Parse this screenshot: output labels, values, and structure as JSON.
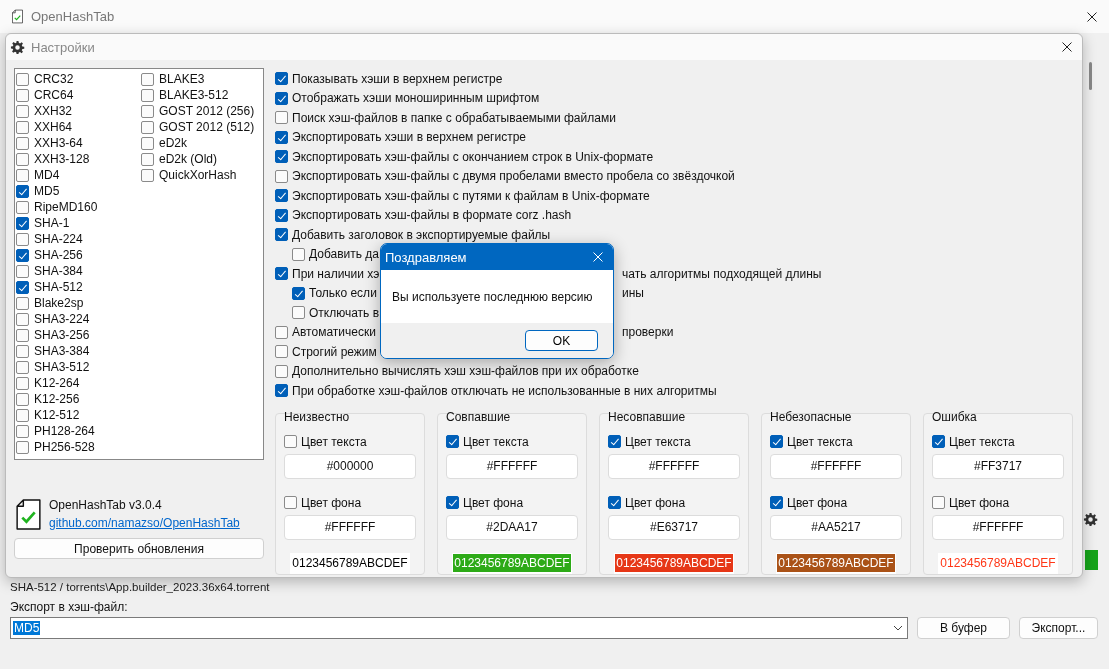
{
  "window": {
    "title": "OpenHashTab"
  },
  "settings": {
    "title": "Настройки",
    "algorithms": [
      {
        "name": "CRC32",
        "checked": false
      },
      {
        "name": "CRC64",
        "checked": false
      },
      {
        "name": "XXH32",
        "checked": false
      },
      {
        "name": "XXH64",
        "checked": false
      },
      {
        "name": "XXH3-64",
        "checked": false
      },
      {
        "name": "XXH3-128",
        "checked": false
      },
      {
        "name": "MD4",
        "checked": false
      },
      {
        "name": "MD5",
        "checked": true
      },
      {
        "name": "RipeMD160",
        "checked": false
      },
      {
        "name": "SHA-1",
        "checked": true
      },
      {
        "name": "SHA-224",
        "checked": false
      },
      {
        "name": "SHA-256",
        "checked": true
      },
      {
        "name": "SHA-384",
        "checked": false
      },
      {
        "name": "SHA-512",
        "checked": true
      },
      {
        "name": "Blake2sp",
        "checked": false
      },
      {
        "name": "SHA3-224",
        "checked": false
      },
      {
        "name": "SHA3-256",
        "checked": false
      },
      {
        "name": "SHA3-384",
        "checked": false
      },
      {
        "name": "SHA3-512",
        "checked": false
      },
      {
        "name": "K12-264",
        "checked": false
      },
      {
        "name": "K12-256",
        "checked": false
      },
      {
        "name": "K12-512",
        "checked": false
      },
      {
        "name": "PH128-264",
        "checked": false
      },
      {
        "name": "PH256-528",
        "checked": false
      },
      {
        "name": "BLAKE3",
        "checked": false
      },
      {
        "name": "BLAKE3-512",
        "checked": false
      },
      {
        "name": "GOST 2012 (256)",
        "checked": false
      },
      {
        "name": "GOST 2012 (512)",
        "checked": false
      },
      {
        "name": "eD2k",
        "checked": false
      },
      {
        "name": "eD2k (Old)",
        "checked": false
      },
      {
        "name": "QuickXorHash",
        "checked": false
      }
    ],
    "version": "OpenHashTab v3.0.4",
    "link": "github.com/namazso/OpenHashTab",
    "update_button": "Проверить обновления",
    "options": [
      {
        "text": "Показывать хэши в верхнем регистре",
        "checked": true
      },
      {
        "text": "Отображать хэши моноширинным шрифтом",
        "checked": true
      },
      {
        "text": "Поиск хэш-файлов в папке с обрабатываемыми файлами",
        "checked": false
      },
      {
        "text": "Экспортировать хэши в верхнем регистре",
        "checked": true
      },
      {
        "text": "Экспортировать хэш-файлы с окончанием строк в Unix-формате",
        "checked": true
      },
      {
        "text": "Экспортировать хэш-файлы с двумя пробелами вместо пробела со звёздочкой",
        "checked": false
      },
      {
        "text": "Экспортировать хэш-файлы с путями к файлам в Unix-формате",
        "checked": true
      },
      {
        "text": "Экспортировать хэш-файлы в формате corz .hash",
        "checked": true
      },
      {
        "text": "Добавить заголовок в экспортируемые файлы",
        "checked": true,
        "children": [
          {
            "text": "Добавить да",
            "checked": false
          }
        ]
      },
      {
        "text": "При наличии хэ",
        "text_after_dialog": "чать алгоритмы подходящей длины",
        "checked": true,
        "children": [
          {
            "text": "Только если",
            "text_after_dialog": "ины",
            "checked": true
          },
          {
            "text": "Отключать в",
            "checked": false
          }
        ]
      },
      {
        "text": "Автоматически",
        "text_after_dialog": "проверки",
        "checked": false
      },
      {
        "text": "Строгий режим",
        "checked": false
      },
      {
        "text": "Дополнительно вычислять хэш хэш-файлов при их обработке",
        "checked": false
      },
      {
        "text": "При обработке хэш-файлов отключать не использованные в них алгоритмы",
        "checked": true
      }
    ],
    "color_groups": [
      {
        "title": "Неизвестно",
        "text_color": {
          "label": "Цвет текста",
          "checked": false,
          "value": "#000000"
        },
        "background_color": {
          "label": "Цвет фона",
          "checked": false,
          "value": "#FFFFFF"
        },
        "sample": "0123456789ABCDEF"
      },
      {
        "title": "Совпавшие",
        "text_color": {
          "label": "Цвет текста",
          "checked": true,
          "value": "#FFFFFF"
        },
        "background_color": {
          "label": "Цвет фона",
          "checked": true,
          "value": "#2DAA17"
        },
        "sample": "0123456789ABCDEF"
      },
      {
        "title": "Несовпавшие",
        "text_color": {
          "label": "Цвет текста",
          "checked": true,
          "value": "#FFFFFF"
        },
        "background_color": {
          "label": "Цвет фона",
          "checked": true,
          "value": "#E63717"
        },
        "sample": "0123456789ABCDEF"
      },
      {
        "title": "Небезопасные",
        "text_color": {
          "label": "Цвет текста",
          "checked": true,
          "value": "#FFFFFF"
        },
        "background_color": {
          "label": "Цвет фона",
          "checked": true,
          "value": "#AA5217"
        },
        "sample": "0123456789ABCDEF"
      },
      {
        "title": "Ошибка",
        "text_color": {
          "label": "Цвет текста",
          "checked": true,
          "value": "#FF3717"
        },
        "background_color": {
          "label": "Цвет фона",
          "checked": false,
          "value": "#FFFFFF"
        },
        "sample": "0123456789ABCDEF"
      }
    ]
  },
  "message_dialog": {
    "title": "Поздравляем",
    "message": "Вы используете последнюю версию",
    "ok_button": "OK"
  },
  "main": {
    "file_line": "SHA-512 / torrents\\App.builder_2023.36x64.torrent",
    "export_label": "Экспорт в хэш-файл:",
    "export_format": "MD5",
    "copy_button": "В буфер",
    "export_button": "Экспорт...",
    "progress": {
      "level": 1
    }
  }
}
